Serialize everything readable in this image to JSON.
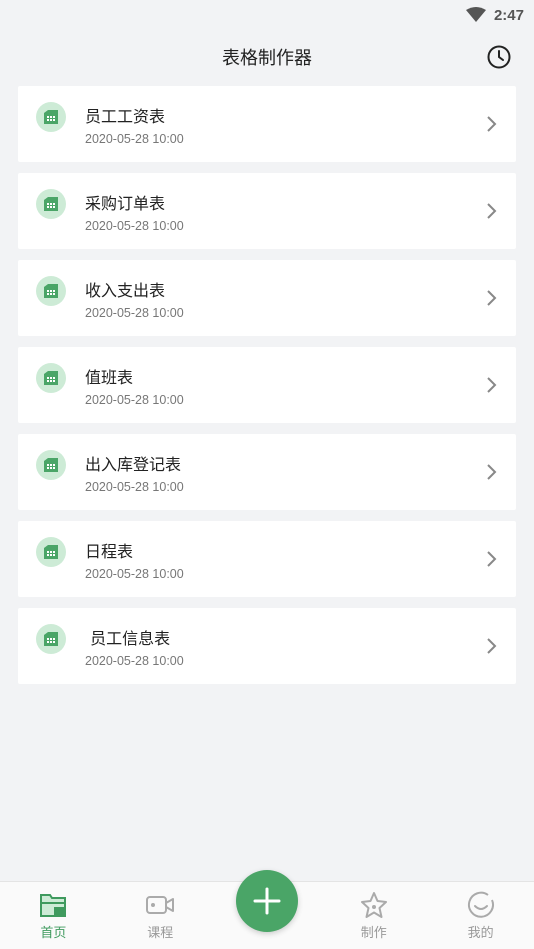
{
  "status_bar": {
    "time": "2:47"
  },
  "header": {
    "title": "表格制作器"
  },
  "items": [
    {
      "name": "员工工资表",
      "date": "2020-05-28 10:00"
    },
    {
      "name": "采购订单表",
      "date": "2020-05-28 10:00"
    },
    {
      "name": "收入支出表",
      "date": "2020-05-28 10:00"
    },
    {
      "name": "值班表",
      "date": "2020-05-28 10:00"
    },
    {
      "name": "出入库登记表",
      "date": "2020-05-28 10:00"
    },
    {
      "name": "日程表",
      "date": "2020-05-28 10:00"
    },
    {
      "name": " 员工信息表",
      "date": "2020-05-28 10:00"
    }
  ],
  "tabs": [
    {
      "label": "首页",
      "icon": "folder-icon",
      "active": true
    },
    {
      "label": "课程",
      "icon": "video-camera-icon",
      "active": false
    },
    {
      "label": "",
      "icon": "add-icon",
      "active": false
    },
    {
      "label": "制作",
      "icon": "star-icon",
      "active": false
    },
    {
      "label": "我的",
      "icon": "smile-icon",
      "active": false
    }
  ],
  "colors": {
    "accent": "#4aa567",
    "background": "#f2f3f5",
    "icon_bg": "#cdebd6"
  }
}
